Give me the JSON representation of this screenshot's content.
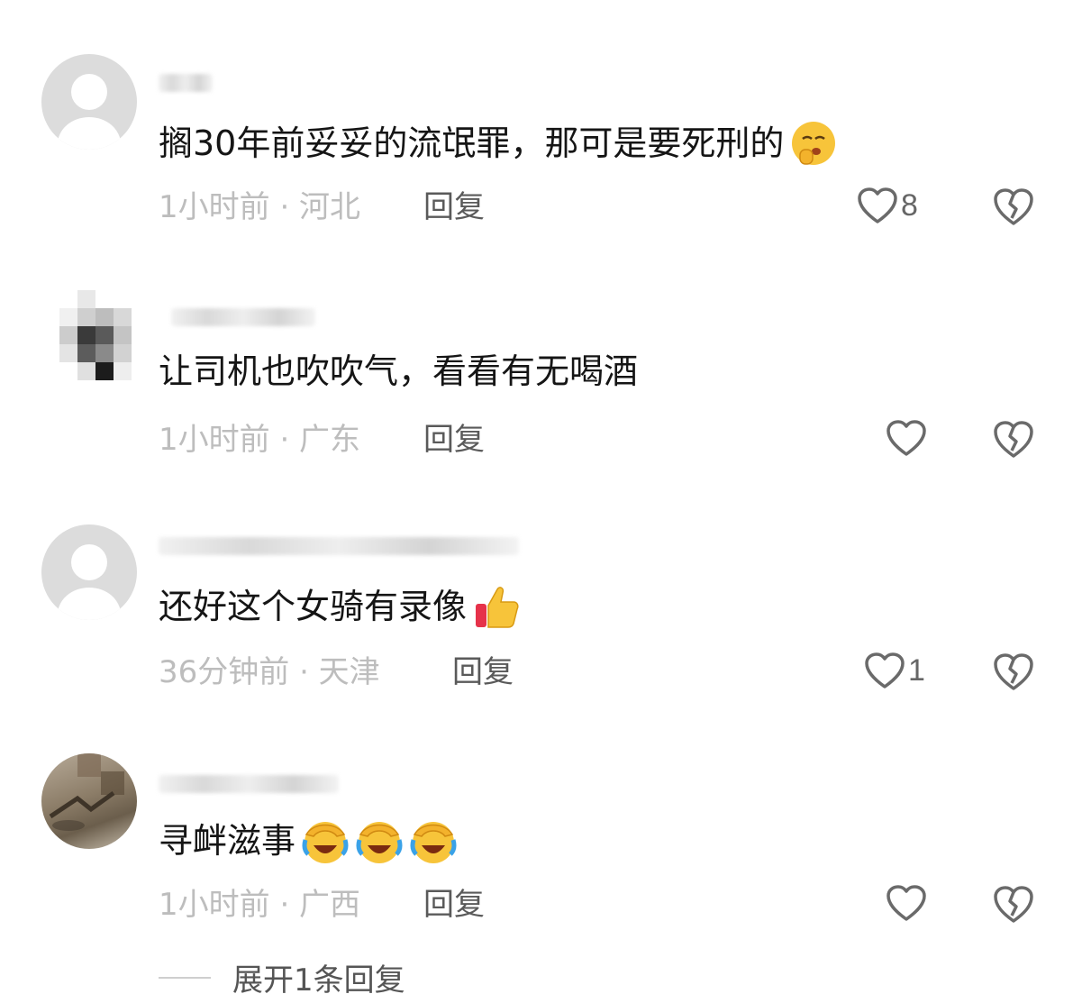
{
  "comments": [
    {
      "text": "搁30年前妥妥的流氓罪，那可是要死刑的",
      "emoji": "shushing-face-emoji",
      "time_location": "1小时前 · 河北",
      "reply_label": "回复",
      "likes": "8"
    },
    {
      "text": "让司机也吹吹气，看看有无喝酒",
      "time_location": "1小时前 · 广东",
      "reply_label": "回复",
      "likes": ""
    },
    {
      "text": "还好这个女骑有录像",
      "emoji": "thumbs-up-emoji",
      "time_location": "36分钟前 · 天津",
      "reply_label": "回复",
      "likes": "1"
    },
    {
      "text": "寻衅滋事",
      "emoji": "face-palm-laugh-emoji",
      "emoji_count": 3,
      "time_location": "1小时前 · 广西",
      "reply_label": "回复",
      "likes": ""
    }
  ],
  "expand_replies_label": "展开1条回复",
  "colors": {
    "text": "#151515",
    "meta": "#bdbdbd",
    "reply": "#5a5a5a",
    "icon": "#6a6a6a"
  }
}
